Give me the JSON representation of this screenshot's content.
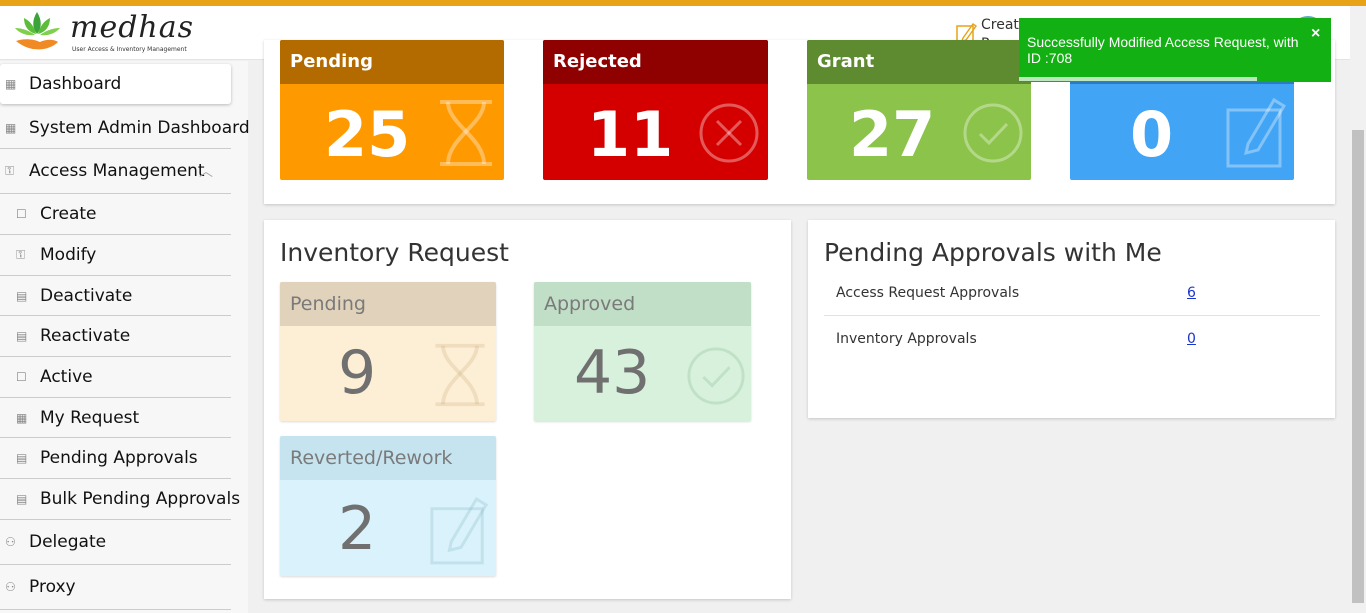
{
  "header": {
    "logo_word": "medhas",
    "logo_tagline": "User Access & Inventory Management",
    "create_request_label": "Create\nReque"
  },
  "sidebar": {
    "items": [
      {
        "label": "Dashboard",
        "icon": "grid-icon"
      },
      {
        "label": "System Admin Dashboard",
        "icon": "grid-icon"
      },
      {
        "label": "Access Management",
        "icon": "key-icon"
      },
      {
        "label": "Create",
        "icon": "edit-icon"
      },
      {
        "label": "Modify",
        "icon": "key-icon"
      },
      {
        "label": "Deactivate",
        "icon": "document-icon"
      },
      {
        "label": "Reactivate",
        "icon": "document-icon"
      },
      {
        "label": "Active",
        "icon": "edit-icon"
      },
      {
        "label": "My Request",
        "icon": "table-icon"
      },
      {
        "label": "Pending Approvals",
        "icon": "clipboard-icon"
      },
      {
        "label": "Bulk Pending Approvals",
        "icon": "clipboard-icon"
      },
      {
        "label": "Delegate",
        "icon": "users-icon"
      },
      {
        "label": "Proxy",
        "icon": "users-icon"
      }
    ]
  },
  "access_tiles": [
    {
      "title": "Pending",
      "value": "25",
      "color": "#ff9900",
      "head_color": "#b36b00",
      "icon": "hourglass-icon"
    },
    {
      "title": "Rejected",
      "value": "11",
      "color": "#d40000",
      "head_color": "#8f0000",
      "icon": "x-circle-icon"
    },
    {
      "title": "Grant",
      "value": "27",
      "color": "#8cc34a",
      "head_color": "#5e8a30",
      "icon": "check-circle-icon"
    },
    {
      "title": "",
      "value": "0",
      "color": "#41a4f4",
      "head_color": "#2a7bbf",
      "icon": "edit-icon"
    }
  ],
  "inventory": {
    "title": "Inventory Request",
    "tiles": [
      {
        "title": "Pending",
        "value": "9",
        "icon": "hourglass-icon"
      },
      {
        "title": "Approved",
        "value": "43",
        "icon": "check-circle-icon"
      },
      {
        "title": "Reverted/Rework",
        "value": "2",
        "icon": "edit-icon"
      }
    ]
  },
  "approvals": {
    "title": "Pending Approvals with Me",
    "rows": [
      {
        "label": "Access Request Approvals",
        "count": "6"
      },
      {
        "label": "Inventory Approvals",
        "count": "0"
      }
    ]
  },
  "toast": {
    "message": "Successfully Modified Access Request, with ID :708",
    "close": "×"
  }
}
